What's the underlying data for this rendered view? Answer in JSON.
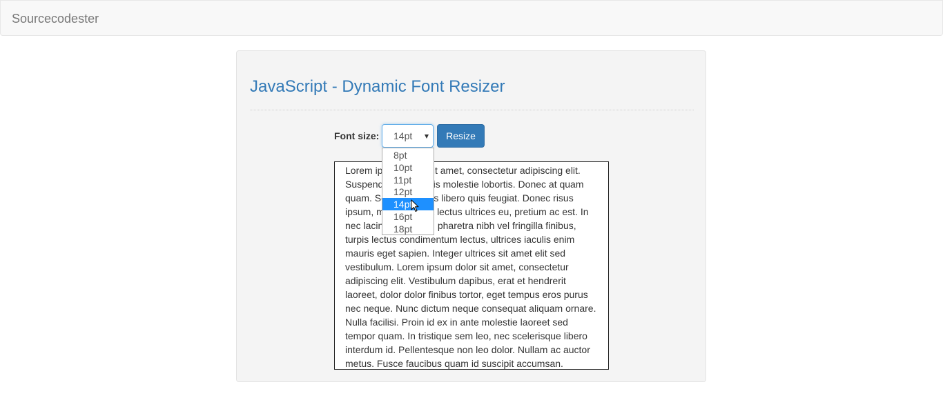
{
  "navbar": {
    "brand": "Sourcecodester"
  },
  "main": {
    "title": "JavaScript - Dynamic Font Resizer",
    "font_size_label": "Font size:",
    "select": {
      "value": "14pt",
      "options": [
        "8pt",
        "10pt",
        "11pt",
        "12pt",
        "14pt",
        "16pt",
        "18pt"
      ],
      "selected_index": 4
    },
    "resize_button": "Resize",
    "paragraph": "Lorem ipsum dolor sit amet, consectetur adipiscing elit. Suspendisse a mauris molestie lobortis. Donec at quam quam. Sed vel mauris libero quis feugiat. Donec risus ipsum, malesuada ut lectus ultrices eu, pretium ac est. In nec lacinia arcu. Sed pharetra nibh vel fringilla finibus, turpis lectus condimentum lectus, ultrices iaculis enim mauris eget sapien. Integer ultrices sit amet elit sed vestibulum. Lorem ipsum dolor sit amet, consectetur adipiscing elit. Vestibulum dapibus, erat et hendrerit laoreet, dolor dolor finibus tortor, eget tempus eros purus nec neque. Nunc dictum neque consequat aliquam ornare. Nulla facilisi. Proin id ex in ante molestie laoreet sed tempor quam. In tristique sem leo, nec scelerisque libero interdum id. Pellentesque non leo dolor. Nullam ac auctor metus. Fusce faucibus quam id suscipit accumsan."
  },
  "colors": {
    "link_blue": "#337ab7",
    "selection_blue": "#1e90ff",
    "navbar_bg": "#f8f8f8",
    "well_bg": "#f4f4f4"
  }
}
